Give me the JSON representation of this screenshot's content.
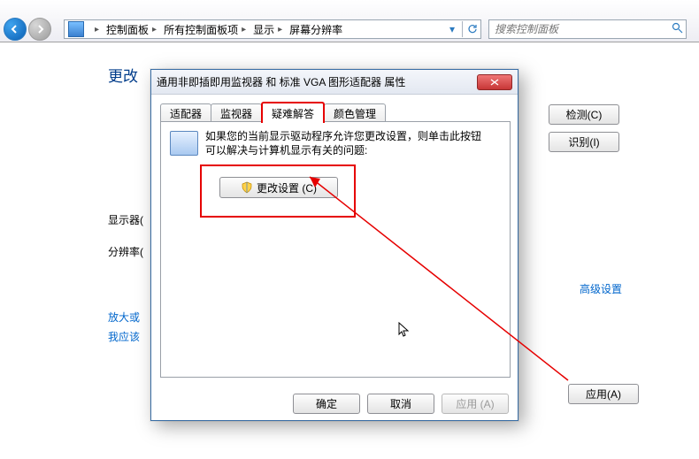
{
  "sys": {
    "min": "—",
    "max": "▭"
  },
  "breadcrumbs": {
    "items": [
      "控制面板",
      "所有控制面板项",
      "显示",
      "屏幕分辨率"
    ]
  },
  "search": {
    "placeholder": "搜索控制面板"
  },
  "main": {
    "heading_cut": "更改",
    "label_monitor": "显示器(",
    "label_resolution": "分辨率(",
    "link_enlarge": "放大或",
    "link_whatuse": "我应该",
    "btn_detect": "检测(C)",
    "btn_identify": "识别(I)",
    "link_adv": "高级设置",
    "btn_applyA": "应用(A)"
  },
  "dialog": {
    "title": "通用非即插即用监视器 和 标准 VGA 图形适配器 属性",
    "tabs": [
      "适配器",
      "监视器",
      "疑难解答",
      "颜色管理"
    ],
    "active_tab": 2,
    "tip_line1": "如果您的当前显示驱动程序允许您更改设置，则单击此按钮",
    "tip_line2": "可以解决与计算机显示有关的问题:",
    "change_btn": "更改设置 (C)",
    "ok": "确定",
    "cancel": "取消",
    "apply": "应用 (A)"
  }
}
